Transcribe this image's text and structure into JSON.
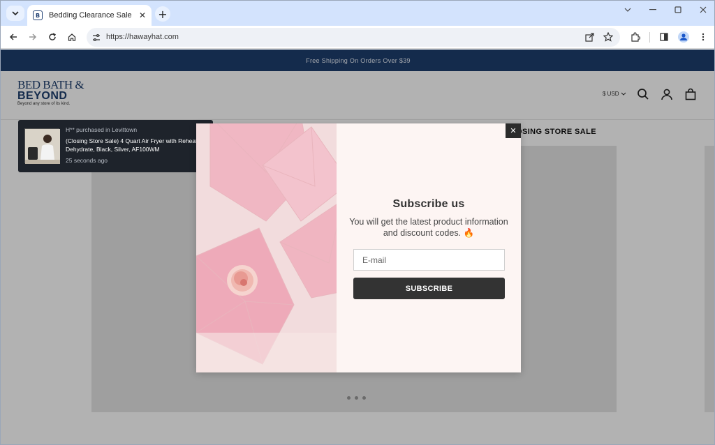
{
  "browser": {
    "tab_title": "Bedding Clearance Sale",
    "url": "https://hawayhat.com",
    "favicon_glyph": "B",
    "icons": [
      "tab-search-icon",
      "close-icon",
      "new-tab-icon",
      "back-icon",
      "forward-icon",
      "reload-icon",
      "home-icon",
      "site-settings-icon",
      "share-icon",
      "bookmark-star-icon",
      "extensions-icon",
      "side-panel-icon",
      "profile-icon",
      "menu-icon"
    ]
  },
  "site": {
    "announcement": "Free Shipping On Orders Over $39",
    "logo": {
      "line1": "BED BATH &",
      "line2": "BEYOND",
      "tagline": "Beyond any store of its kind."
    },
    "currency": "$ USD",
    "nav_text": "OSING STORE SALE"
  },
  "toast": {
    "meta": "H** purchased in Levittown",
    "product": "(Closing Store Sale) 4 Quart Air Fryer with Reheat & Dehydrate, Black, Silver, AF100WM",
    "time": "25 seconds ago"
  },
  "modal": {
    "title": "Subscribe us",
    "description": "You will get the latest product information and discount codes.",
    "emoji": "🔥",
    "email_placeholder": "E-mail",
    "button_label": "SUBSCRIBE",
    "close_glyph": "✕"
  },
  "colors": {
    "brand_navy": "#1e3e6e",
    "button_dark": "#333333",
    "modal_bg": "#fdf5f3"
  }
}
